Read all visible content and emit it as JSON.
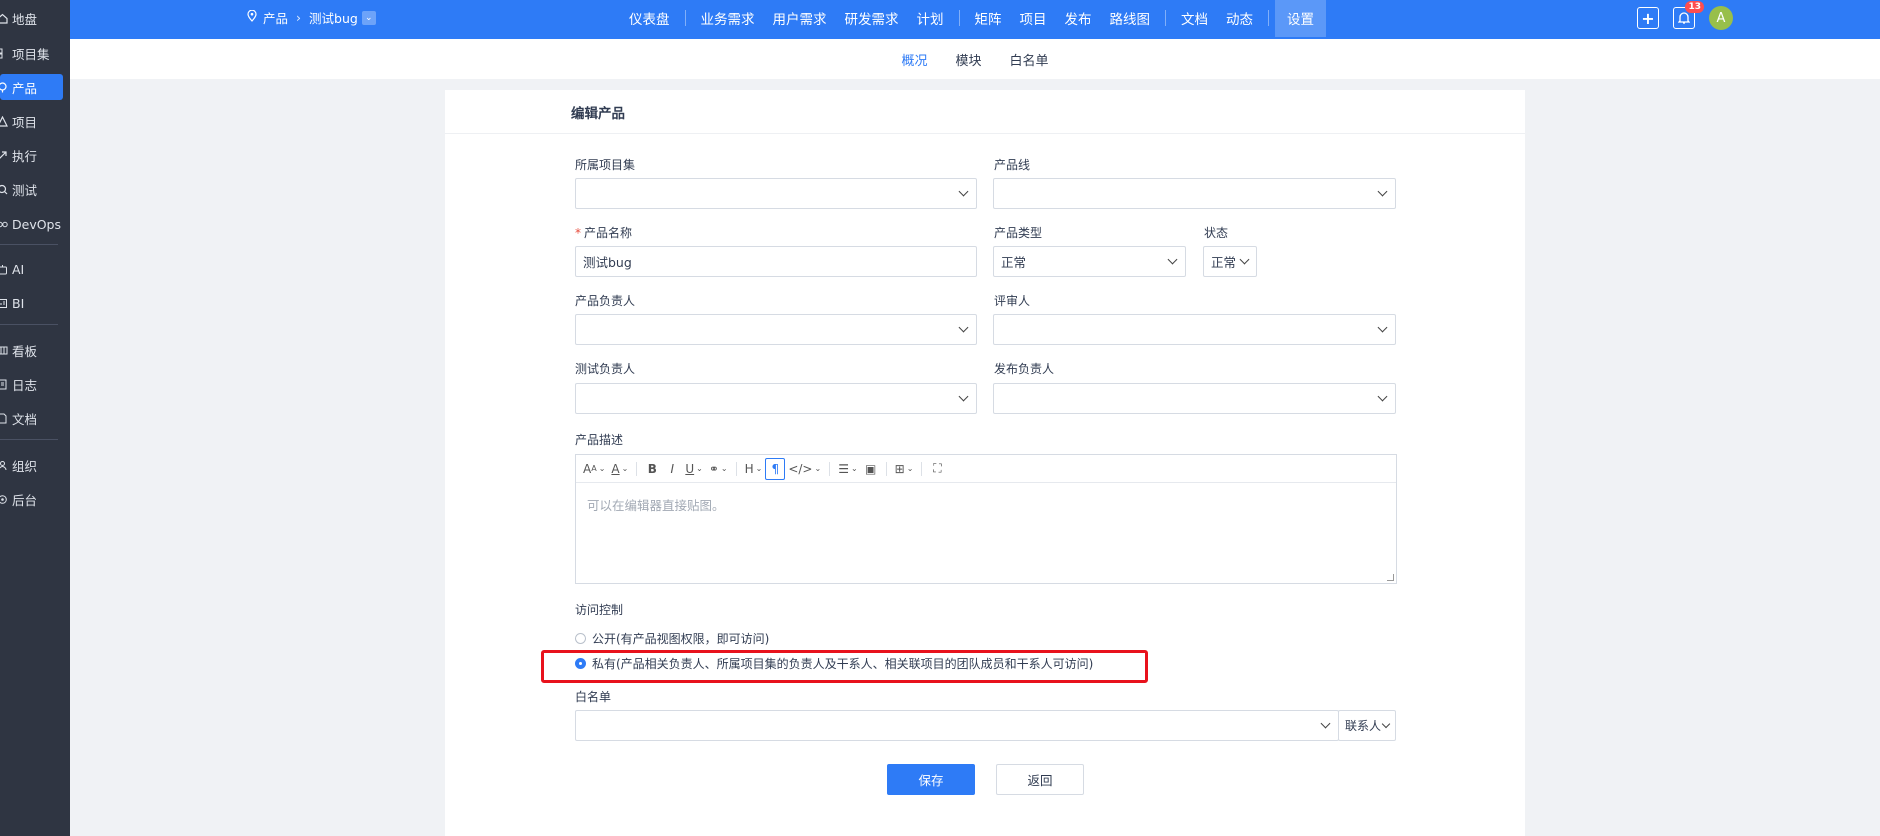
{
  "sidebar": {
    "items": [
      {
        "label": "地盘",
        "icon": "home-icon"
      },
      {
        "label": "项目集",
        "icon": "program-icon"
      },
      {
        "label": "产品",
        "icon": "product-icon"
      },
      {
        "label": "项目",
        "icon": "project-icon"
      },
      {
        "label": "执行",
        "icon": "execution-icon"
      },
      {
        "label": "测试",
        "icon": "test-icon"
      },
      {
        "label": "DevOps",
        "icon": "devops-icon"
      },
      {
        "label": "AI",
        "icon": "ai-icon"
      },
      {
        "label": "BI",
        "icon": "bi-icon"
      },
      {
        "label": "看板",
        "icon": "kanban-icon"
      },
      {
        "label": "日志",
        "icon": "log-icon"
      },
      {
        "label": "文档",
        "icon": "doc-icon"
      },
      {
        "label": "组织",
        "icon": "org-icon"
      },
      {
        "label": "后台",
        "icon": "admin-icon"
      }
    ],
    "active": "产品"
  },
  "topbar": {
    "breadcrumb": {
      "module": "产品",
      "current": "测试bug"
    },
    "nav": [
      "仪表盘",
      "业务需求",
      "用户需求",
      "研发需求",
      "计划",
      "矩阵",
      "项目",
      "发布",
      "路线图",
      "文档",
      "动态",
      "设置"
    ],
    "active_nav": "设置",
    "notification_count": "13",
    "avatar_letter": "A"
  },
  "subnav": {
    "items": [
      "概况",
      "模块",
      "白名单"
    ],
    "active": "概况"
  },
  "form": {
    "title": "编辑产品",
    "program_label": "所属项目集",
    "program_value": "",
    "line_label": "产品线",
    "line_value": "",
    "name_label": "产品名称",
    "name_value": "测试bug",
    "type_label": "产品类型",
    "type_value": "正常",
    "status_label": "状态",
    "status_value": "正常",
    "po_label": "产品负责人",
    "reviewer_label": "评审人",
    "qd_label": "测试负责人",
    "rd_label": "发布负责人",
    "desc_label": "产品描述",
    "desc_placeholder": "可以在编辑器直接贴图。",
    "acl_label": "访问控制",
    "acl_open": "公开(有产品视图权限，即可访问)",
    "acl_private": "私有(产品相关负责人、所属项目集的负责人及干系人、相关联项目的团队成员和干系人可访问)",
    "acl_selected": "private",
    "whitelist_label": "白名单",
    "whitelist_contacts": "联系人",
    "save": "保存",
    "back": "返回"
  },
  "colors": {
    "primary": "#2e7bf6",
    "sidebar": "#2f3542",
    "highlight": "#e8121c"
  }
}
